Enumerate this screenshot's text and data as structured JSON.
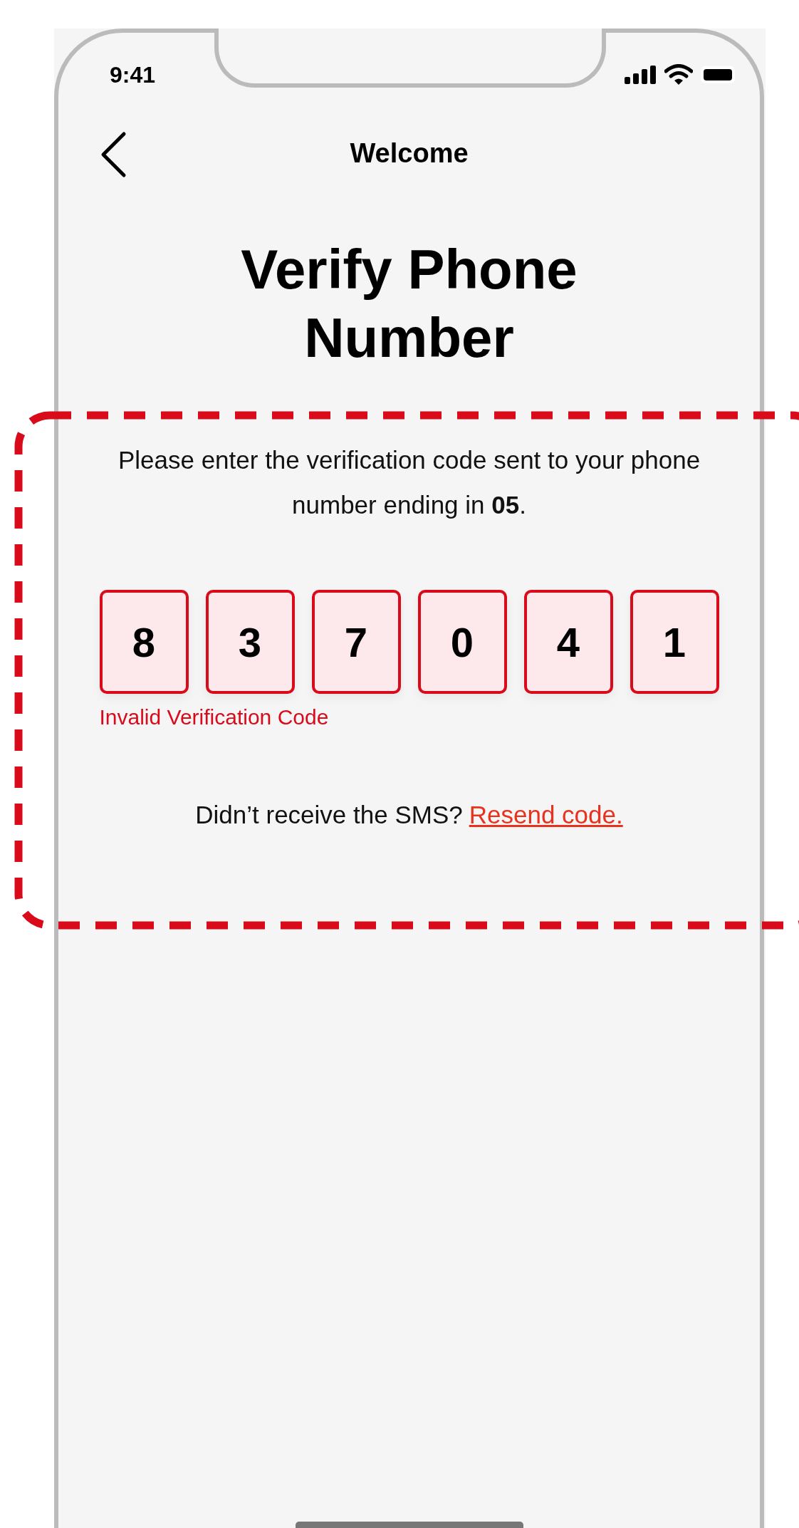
{
  "status_bar": {
    "time": "9:41"
  },
  "nav": {
    "title": "Welcome"
  },
  "heading": "Verify Phone Number",
  "instructions": "Please enter the verification code sent to your phone number ending in **05**.",
  "code": {
    "digits": [
      "8",
      "3",
      "7",
      "0",
      "4",
      "1"
    ],
    "invalid": true,
    "error": "Invalid Verification Code"
  },
  "resend": {
    "prompt": "Didn’t receive the SMS?",
    "link": "Resend code."
  }
}
